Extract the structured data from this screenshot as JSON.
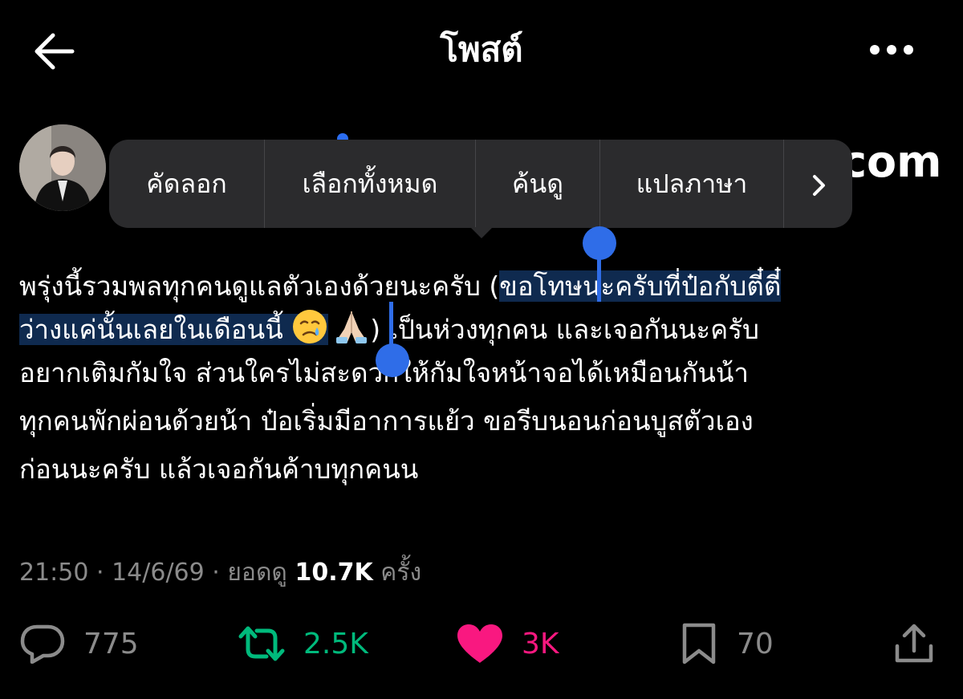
{
  "header": {
    "title": "โพสต์",
    "back_icon": "arrow-left-icon",
    "more_icon": "ellipsis-icon"
  },
  "author": {
    "avatar": "avatar",
    "handle_tail": "com"
  },
  "context_menu": {
    "copy": "คัดลอก",
    "select_all": "เลือกทั้งหมด",
    "look_up": "ค้นดู",
    "translate": "แปลภาษา",
    "more_icon": "chevron-right-icon"
  },
  "post": {
    "l1_a": "พรุ่งนี้รวมพลทุกคนดูแลตัวเองด้วยนะครับ (",
    "l1_b": "ขอโทษนะครับที่ป๋อกับตี๋ตี๋",
    "l2_a": "ว่างแค่นั้นเลยในเดือนนี้ ",
    "l2_b": ") เป็นห่วงทุกคน และเจอกันนะครับ",
    "l3": "อยากเติมกัมใจ ส่วนใครไม่สะดวกให้กัมใจหน้าจอได้เหมือนกันน้า",
    "l4": "ทุกคนพักผ่อนด้วยน้า ป๋อเริ่มมีอาการแย้ว ขอรีบนอนก่อนบูสตัวเอง",
    "l5": "ก่อนนะครับ แล้วเจอกันค้าบทุกคนน",
    "emojis": [
      "crying-face-emoji",
      "folded-hands-emoji"
    ]
  },
  "meta": {
    "time": "21:50",
    "date": "14/6/69",
    "views_label": "ยอดดู",
    "views": "10.7K",
    "views_unit": "ครั้ง"
  },
  "actions": {
    "reply_count": "775",
    "repost_count": "2.5K",
    "like_count": "3K",
    "bookmark_count": "70",
    "colors": {
      "repost": "#00ba7c",
      "like": "#f91880",
      "muted": "#8b8b8b"
    }
  }
}
